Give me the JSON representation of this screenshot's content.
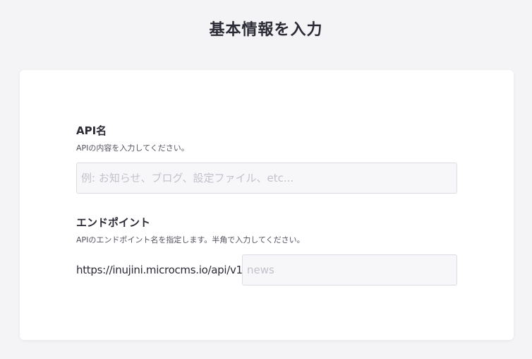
{
  "page": {
    "title": "基本情報を入力"
  },
  "api_name": {
    "label": "API名",
    "description": "APIの内容を入力してください。",
    "value": "",
    "placeholder": "例: お知らせ、ブログ、設定ファイル、etc..."
  },
  "endpoint": {
    "label": "エンドポイント",
    "description": "APIのエンドポイント名を指定します。半角で入力してください。",
    "prefix": "https://inujini.microcms.io/api/v1/",
    "value": "",
    "placeholder": "news"
  }
}
